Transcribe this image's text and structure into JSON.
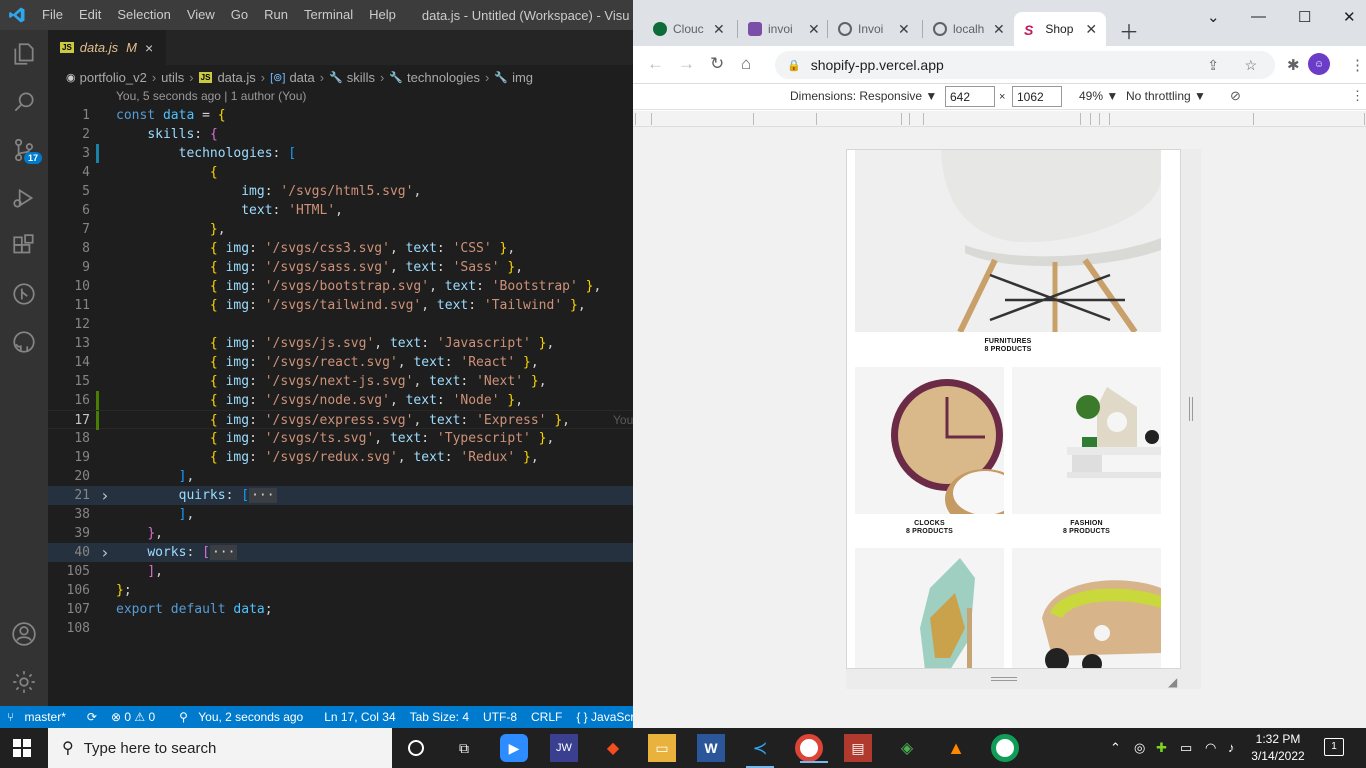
{
  "vscode": {
    "menu": [
      "File",
      "Edit",
      "Selection",
      "View",
      "Go",
      "Run",
      "Terminal",
      "Help"
    ],
    "window_title": "data.js - Untitled (Workspace) - Visu",
    "tab": {
      "filename": "data.js",
      "modified": "M",
      "close": "×"
    },
    "breadcrumb": [
      "portfolio_v2",
      "utils",
      "data.js",
      "data",
      "skills",
      "technologies",
      "img"
    ],
    "blame": "You, 5 seconds ago | 1 author (You)",
    "inline_blame": "You",
    "activity_badge": "17",
    "lines": [
      {
        "n": "1",
        "html": "<span class='k'>const</span> <span class='v'>data</span> = <span class='b1'>{</span>"
      },
      {
        "n": "2",
        "html": "    <span class='p'>skills</span>: <span class='b2'>{</span>"
      },
      {
        "n": "3",
        "html": "        <span class='p'>technologies</span>: <span class='b3'>[</span>"
      },
      {
        "n": "4",
        "html": "            <span class='b1'>{</span>"
      },
      {
        "n": "5",
        "html": "                <span class='p'>img</span>: <span class='s'>'/svgs/html5.svg'</span>,"
      },
      {
        "n": "6",
        "html": "                <span class='p'>text</span>: <span class='s'>'HTML'</span>,"
      },
      {
        "n": "7",
        "html": "            <span class='b1'>}</span>,"
      },
      {
        "n": "8",
        "html": "            <span class='b1'>{</span> <span class='p'>img</span>: <span class='s'>'/svgs/css3.svg'</span>, <span class='p'>text</span>: <span class='s'>'CSS'</span> <span class='b1'>}</span>,"
      },
      {
        "n": "9",
        "html": "            <span class='b1'>{</span> <span class='p'>img</span>: <span class='s'>'/svgs/sass.svg'</span>, <span class='p'>text</span>: <span class='s'>'Sass'</span> <span class='b1'>}</span>,"
      },
      {
        "n": "10",
        "html": "            <span class='b1'>{</span> <span class='p'>img</span>: <span class='s'>'/svgs/bootstrap.svg'</span>, <span class='p'>text</span>: <span class='s'>'Bootstrap'</span> <span class='b1'>}</span>,"
      },
      {
        "n": "11",
        "html": "            <span class='b1'>{</span> <span class='p'>img</span>: <span class='s'>'/svgs/tailwind.svg'</span>, <span class='p'>text</span>: <span class='s'>'Tailwind'</span> <span class='b1'>}</span>,"
      },
      {
        "n": "12",
        "html": ""
      },
      {
        "n": "13",
        "html": "            <span class='b1'>{</span> <span class='p'>img</span>: <span class='s'>'/svgs/js.svg'</span>, <span class='p'>text</span>: <span class='s'>'Javascript'</span> <span class='b1'>}</span>,"
      },
      {
        "n": "14",
        "html": "            <span class='b1'>{</span> <span class='p'>img</span>: <span class='s'>'/svgs/react.svg'</span>, <span class='p'>text</span>: <span class='s'>'React'</span> <span class='b1'>}</span>,"
      },
      {
        "n": "15",
        "html": "            <span class='b1'>{</span> <span class='p'>img</span>: <span class='s'>'/svgs/next-js.svg'</span>, <span class='p'>text</span>: <span class='s'>'Next'</span> <span class='b1'>}</span>,"
      },
      {
        "n": "16",
        "html": "            <span class='b1'>{</span> <span class='p'>img</span>: <span class='s'>'/svgs/node.svg'</span>, <span class='p'>text</span>: <span class='s'>'Node'</span> <span class='b1'>}</span>,"
      },
      {
        "n": "17",
        "html": "            <span class='b1'>{</span> <span class='p'>img</span>: <span class='s'>'/svgs/express.svg'</span>, <span class='p'>text</span>: <span class='s'>'Express'</span> <span class='b1'>}</span>,"
      },
      {
        "n": "18",
        "html": "            <span class='b1'>{</span> <span class='p'>img</span>: <span class='s'>'/svgs/ts.svg'</span>, <span class='p'>text</span>: <span class='s'>'Typescript'</span> <span class='b1'>}</span>,"
      },
      {
        "n": "19",
        "html": "            <span class='b1'>{</span> <span class='p'>img</span>: <span class='s'>'/svgs/redux.svg'</span>, <span class='p'>text</span>: <span class='s'>'Redux'</span> <span class='b1'>}</span>,"
      },
      {
        "n": "20",
        "html": "        <span class='b3'>]</span>,"
      },
      {
        "n": "21",
        "html": "        <span class='p'>quirks</span>: <span class='b3'>[</span><span class='ell'>···</span>"
      },
      {
        "n": "38",
        "html": "        <span class='b3'>]</span>,"
      },
      {
        "n": "39",
        "html": "    <span class='b2'>}</span>,"
      },
      {
        "n": "40",
        "html": "    <span class='p'>works</span>: <span class='b2'>[</span><span class='ell'>···</span>"
      },
      {
        "n": "105",
        "html": "    <span class='b2'>]</span>,"
      },
      {
        "n": "106",
        "html": "<span class='b1'>}</span>;"
      },
      {
        "n": "107",
        "html": "<span class='k'>export</span> <span class='k'>default</span> <span class='v'>data</span>;"
      },
      {
        "n": "108",
        "html": ""
      }
    ],
    "status": {
      "branch": "master*",
      "problems": "⊗ 0 ⚠ 0",
      "blame": "You, 2 seconds ago",
      "position": "Ln 17, Col 34",
      "tabsize": "Tab Size: 4",
      "encoding": "UTF-8",
      "eol": "CRLF",
      "lang": "{ } JavaScri"
    }
  },
  "chrome": {
    "tabs": [
      {
        "title": "Clouc",
        "color": "#0e6b3a"
      },
      {
        "title": "invoi",
        "color": "#7b4fa8"
      },
      {
        "title": "Invoi",
        "color": "#5f6368"
      },
      {
        "title": "localh",
        "color": "#5f6368"
      },
      {
        "title": "Shop",
        "color": "#c2185b"
      }
    ],
    "url": "shopify-pp.vercel.app",
    "devtools": {
      "dimensions": "Dimensions: Responsive ▼",
      "width": "642",
      "height": "1062",
      "zoom": "49% ▼",
      "throttle": "No throttling ▼"
    },
    "categories": [
      {
        "name": "FURNITURES",
        "count": "8 PRODUCTS"
      },
      {
        "name": "CLOCKS",
        "count": "8 PRODUCTS"
      },
      {
        "name": "FASHION",
        "count": "8 PRODUCTS"
      }
    ]
  },
  "taskbar": {
    "search_placeholder": "Type here to search",
    "time": "1:32 PM",
    "date": "3/14/2022",
    "notifications": "1"
  }
}
